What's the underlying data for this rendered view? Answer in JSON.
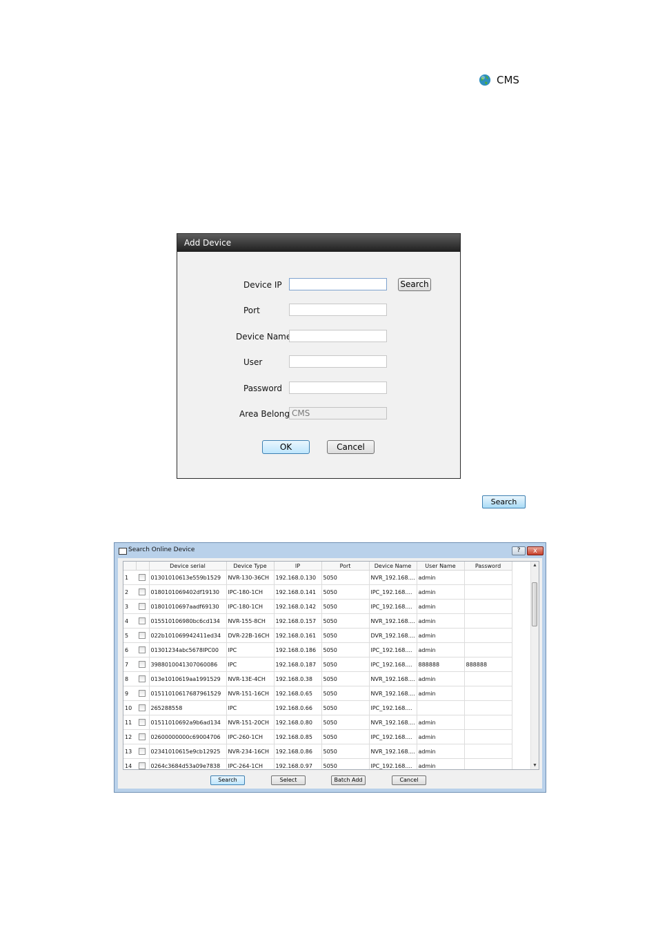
{
  "cms_tree": {
    "label": "CMS",
    "icon": "globe-icon"
  },
  "add_device": {
    "title": "Add Device",
    "fields": {
      "device_ip": {
        "label": "Device IP",
        "value": ""
      },
      "port": {
        "label": "Port",
        "value": ""
      },
      "device_name": {
        "label": "Device Name",
        "value": ""
      },
      "user": {
        "label": "User",
        "value": ""
      },
      "password": {
        "label": "Password",
        "value": ""
      },
      "area_belong": {
        "label": "Area Belong",
        "value": "CMS"
      }
    },
    "search_button": "Search",
    "ok_button": "OK",
    "cancel_button": "Cancel"
  },
  "search_button_standalone": "Search",
  "search_online": {
    "title": "Search Online Device",
    "help_label": "?",
    "close_label": "x",
    "columns": [
      "Device serial",
      "Device Type",
      "IP",
      "Port",
      "Device Name",
      "User Name",
      "Password"
    ],
    "rows": [
      {
        "no": "1",
        "serial": "01301010613e559b1529",
        "type": "NVR-130-36CH",
        "ip": "192.168.0.130",
        "port": "5050",
        "name": "NVR_192.168....",
        "user": "admin",
        "password": ""
      },
      {
        "no": "2",
        "serial": "0180101069402df19130",
        "type": "IPC-180-1CH",
        "ip": "192.168.0.141",
        "port": "5050",
        "name": "IPC_192.168....",
        "user": "admin",
        "password": ""
      },
      {
        "no": "3",
        "serial": "01801010697aadf69130",
        "type": "IPC-180-1CH",
        "ip": "192.168.0.142",
        "port": "5050",
        "name": "IPC_192.168....",
        "user": "admin",
        "password": ""
      },
      {
        "no": "4",
        "serial": "015510106980bc6cd134",
        "type": "NVR-155-8CH",
        "ip": "192.168.0.157",
        "port": "5050",
        "name": "NVR_192.168....",
        "user": "admin",
        "password": ""
      },
      {
        "no": "5",
        "serial": "022b101069942411ed34",
        "type": "DVR-22B-16CH",
        "ip": "192.168.0.161",
        "port": "5050",
        "name": "DVR_192.168....",
        "user": "admin",
        "password": ""
      },
      {
        "no": "6",
        "serial": "01301234abc5678IPC00",
        "type": "IPC",
        "ip": "192.168.0.186",
        "port": "5050",
        "name": "IPC_192.168....",
        "user": "admin",
        "password": ""
      },
      {
        "no": "7",
        "serial": "3988010041307060086",
        "type": "IPC",
        "ip": "192.168.0.187",
        "port": "5050",
        "name": "IPC_192.168....",
        "user": "888888",
        "password": "888888"
      },
      {
        "no": "8",
        "serial": "013e1010619aa1991529",
        "type": "NVR-13E-4CH",
        "ip": "192.168.0.38",
        "port": "5050",
        "name": "NVR_192.168....",
        "user": "admin",
        "password": ""
      },
      {
        "no": "9",
        "serial": "01511010617687961529",
        "type": "NVR-151-16CH",
        "ip": "192.168.0.65",
        "port": "5050",
        "name": "NVR_192.168....",
        "user": "admin",
        "password": ""
      },
      {
        "no": "10",
        "serial": "265288558",
        "type": "IPC",
        "ip": "192.168.0.66",
        "port": "5050",
        "name": "IPC_192.168....",
        "user": "",
        "password": ""
      },
      {
        "no": "11",
        "serial": "01511010692a9b6ad134",
        "type": "NVR-151-20CH",
        "ip": "192.168.0.80",
        "port": "5050",
        "name": "NVR_192.168....",
        "user": "admin",
        "password": ""
      },
      {
        "no": "12",
        "serial": "02600000000c69004706",
        "type": "IPC-260-1CH",
        "ip": "192.168.0.85",
        "port": "5050",
        "name": "IPC_192.168....",
        "user": "admin",
        "password": ""
      },
      {
        "no": "13",
        "serial": "02341010615e9cb12925",
        "type": "NVR-234-16CH",
        "ip": "192.168.0.86",
        "port": "5050",
        "name": "NVR_192.168....",
        "user": "admin",
        "password": ""
      },
      {
        "no": "14",
        "serial": "0264c3684d53a09e7838",
        "type": "IPC-264-1CH",
        "ip": "192.168.0.97",
        "port": "5050",
        "name": "IPC_192.168....",
        "user": "admin",
        "password": ""
      }
    ],
    "buttons": {
      "search": "Search",
      "select": "Select",
      "batch_add": "Batch Add",
      "cancel": "Cancel"
    }
  }
}
